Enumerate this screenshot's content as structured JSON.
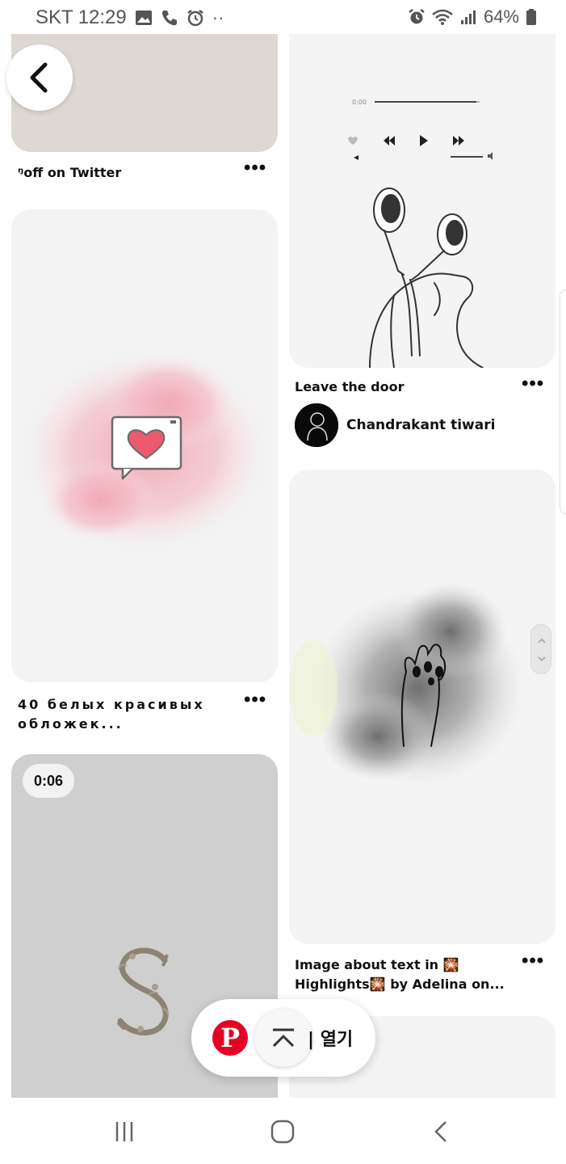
{
  "status_bar": {
    "carrier": "SKT",
    "time": "12:29",
    "dots": "··",
    "battery": "64%",
    "icons": [
      "gallery-icon",
      "phone-icon",
      "alarm-icon",
      "alarm-icon",
      "wifi-icon",
      "signal-icon",
      "battery-icon"
    ]
  },
  "pins": [
    {
      "title": "ᵑoff on Twitter",
      "more": "•••"
    },
    {
      "title": "40 белых красивых обложек...",
      "more": "•••"
    },
    {
      "title": "",
      "duration": "0:06"
    },
    {
      "title": "Leave the door",
      "more": "•••",
      "author": "Chandrakant tiwari"
    },
    {
      "title": "Image about text in 🎇Highlights🎇 by Adelina on...",
      "more": "•••"
    }
  ],
  "player": {
    "time": "0:00"
  },
  "floating_bar": {
    "open_label": "| 열기",
    "logo": "P"
  },
  "colors": {
    "pinterest_red": "#e60023",
    "card_bg": "#f3f3f3",
    "video_bg": "#cfcfcf",
    "beige": "#ddd8d1"
  },
  "nav": [
    "recent-apps-icon",
    "home-icon",
    "back-icon"
  ]
}
